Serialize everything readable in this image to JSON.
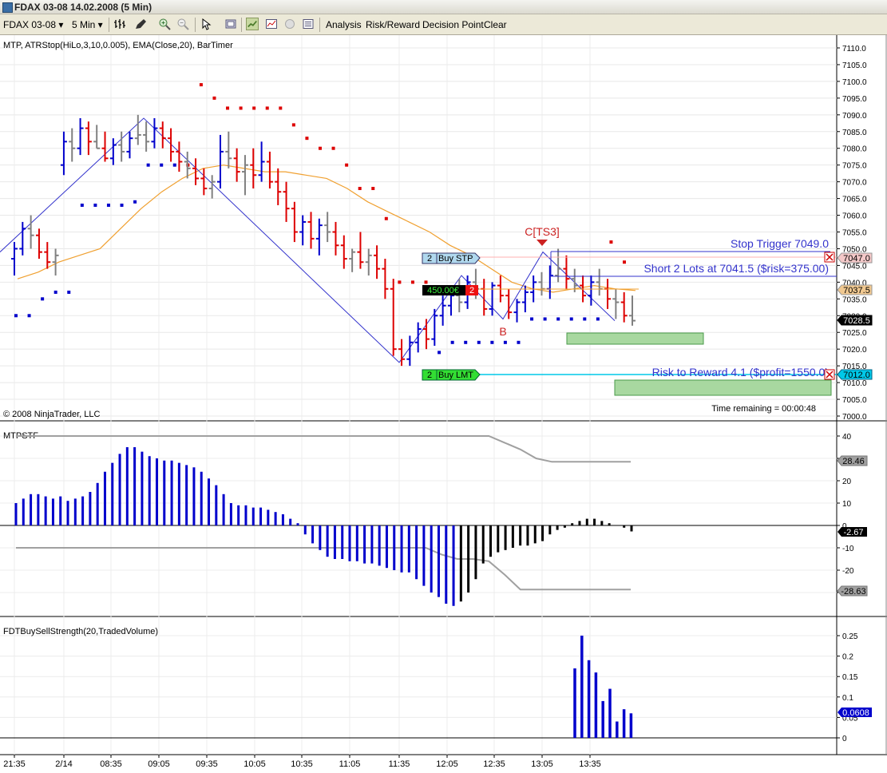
{
  "window": {
    "title": "FDAX 03-08  14.02.2008 (5 Min)"
  },
  "toolbar": {
    "instrument": "FDAX 03-08",
    "interval": "5 Min",
    "menus": [
      "Analysis",
      "Risk/Reward",
      "Decision Point",
      "Clear"
    ]
  },
  "price_panel": {
    "indicator_label": "MTP, ATRStop(HiLo,3,10,0.005), EMA(Close,20), BarTimer",
    "copyright": "© 2008 NinjaTrader, LLC",
    "time_remaining": "Time remaining = 00:00:48",
    "y_ticks": [
      "7110.0",
      "7105.0",
      "7100.0",
      "7095.0",
      "7090.0",
      "7085.0",
      "7080.0",
      "7075.0",
      "7070.0",
      "7065.0",
      "7060.0",
      "7055.0",
      "7050.0",
      "7045.0",
      "7040.0",
      "7035.0",
      "7030.0",
      "7025.0",
      "7020.0",
      "7015.0",
      "7010.0",
      "7005.0",
      "7000.0"
    ],
    "markers": {
      "current": "7028.5",
      "ema": "7037.5",
      "stop": "7047.0",
      "target": "7012.0"
    },
    "annotations": {
      "stop_trigger": "Stop Trigger 7049.0",
      "short": "Short 2 Lots at 7041.5 ($risk=375.00)",
      "risk_reward": "Risk to Reward 4.1 ($profit=1550.0)",
      "point_c": "C[TS3]",
      "point_b": "B"
    },
    "orders": {
      "buy_stp": {
        "qty": "2",
        "label": "Buy STP"
      },
      "position": {
        "pnl": "450.00€",
        "qty": "2"
      },
      "buy_lmt": {
        "qty": "2",
        "label": "Buy LMT"
      }
    },
    "colors": {
      "up_bar": "#0000cc",
      "down_bar": "#dd0000",
      "neutral_bar": "#808080",
      "ema": "#f0a020",
      "zigzag": "#3333cc",
      "atr_stop_long": "#0000cc",
      "atr_stop_short": "#dd0000"
    }
  },
  "osc_panel": {
    "label": "MTPSTF",
    "y_ticks": [
      "40",
      "30",
      "20",
      "10",
      "0",
      "-10",
      "-20",
      "-30"
    ],
    "markers": {
      "upper": "28.46",
      "current": "-2.67",
      "lower": "-28.63"
    }
  },
  "volume_panel": {
    "label": "FDTBuySellStrength(20,TradedVolume)",
    "y_ticks": [
      "0.25",
      "0.2",
      "0.15",
      "0.1",
      "0.05",
      "0"
    ],
    "markers": {
      "current": "0.0608"
    }
  },
  "x_axis": {
    "labels": [
      "21:35",
      "2/14",
      "08:35",
      "09:05",
      "09:35",
      "10:05",
      "10:35",
      "11:05",
      "11:35",
      "12:05",
      "12:35",
      "13:05",
      "13:35"
    ]
  },
  "chart_data": [
    {
      "type": "ohlc",
      "title": "FDAX 03-08 (5 Min)",
      "ylim": [
        7000,
        7110
      ],
      "indicators": [
        "MTP",
        "ATRStop(HiLo,3,10,0.005)",
        "EMA(Close,20)",
        "BarTimer"
      ],
      "ohlc": [
        [
          7047,
          7052,
          7042,
          7050
        ],
        [
          7050,
          7058,
          7048,
          7056
        ],
        [
          7056,
          7060,
          7050,
          7054
        ],
        [
          7054,
          7056,
          7047,
          7049
        ],
        [
          7049,
          7052,
          7044,
          7046
        ],
        [
          7046,
          7050,
          7042,
          7048
        ],
        [
          7075,
          7085,
          7072,
          7082
        ],
        [
          7082,
          7086,
          7076,
          7080
        ],
        [
          7080,
          7089,
          7078,
          7086
        ],
        [
          7086,
          7088,
          7078,
          7082
        ],
        [
          7082,
          7087,
          7080,
          7080
        ],
        [
          7080,
          7085,
          7076,
          7077
        ],
        [
          7077,
          7083,
          7075,
          7081
        ],
        [
          7081,
          7085,
          7076,
          7079
        ],
        [
          7079,
          7085,
          7077,
          7083
        ],
        [
          7083,
          7090,
          7081,
          7084
        ],
        [
          7084,
          7088,
          7079,
          7082
        ],
        [
          7082,
          7089,
          7080,
          7086
        ],
        [
          7086,
          7088,
          7080,
          7083
        ],
        [
          7083,
          7086,
          7076,
          7079
        ],
        [
          7079,
          7082,
          7073,
          7076
        ],
        [
          7076,
          7079,
          7071,
          7074
        ],
        [
          7074,
          7077,
          7069,
          7071
        ],
        [
          7071,
          7074,
          7066,
          7068
        ],
        [
          7068,
          7072,
          7065,
          7070
        ],
        [
          7070,
          7084,
          7068,
          7079
        ],
        [
          7079,
          7085,
          7074,
          7077
        ],
        [
          7077,
          7080,
          7070,
          7073
        ],
        [
          7073,
          7078,
          7066,
          7075
        ],
        [
          7075,
          7080,
          7068,
          7072
        ],
        [
          7072,
          7082,
          7070,
          7076
        ],
        [
          7076,
          7079,
          7068,
          7070
        ],
        [
          7070,
          7074,
          7063,
          7067
        ],
        [
          7067,
          7070,
          7058,
          7062
        ],
        [
          7062,
          7064,
          7052,
          7055
        ],
        [
          7055,
          7060,
          7051,
          7058
        ],
        [
          7058,
          7061,
          7050,
          7053
        ],
        [
          7053,
          7059,
          7048,
          7057
        ],
        [
          7057,
          7061,
          7052,
          7055
        ],
        [
          7055,
          7058,
          7048,
          7051
        ],
        [
          7051,
          7054,
          7044,
          7047
        ],
        [
          7047,
          7050,
          7043,
          7049
        ],
        [
          7049,
          7055,
          7044,
          7046
        ],
        [
          7046,
          7050,
          7042,
          7048
        ],
        [
          7048,
          7051,
          7041,
          7044
        ],
        [
          7044,
          7047,
          7035,
          7038
        ],
        [
          7038,
          7041,
          7018,
          7020
        ],
        [
          7020,
          7023,
          7015,
          7017
        ],
        [
          7017,
          7024,
          7015,
          7022
        ],
        [
          7022,
          7028,
          7019,
          7026
        ],
        [
          7026,
          7029,
          7020,
          7023
        ],
        [
          7023,
          7032,
          7021,
          7030
        ],
        [
          7030,
          7036,
          7027,
          7033
        ],
        [
          7033,
          7039,
          7030,
          7036
        ],
        [
          7036,
          7041,
          7031,
          7034
        ],
        [
          7034,
          7042,
          7032,
          7040
        ],
        [
          7040,
          7044,
          7035,
          7038
        ],
        [
          7038,
          7041,
          7030,
          7032
        ],
        [
          7032,
          7040,
          7030,
          7039
        ],
        [
          7039,
          7042,
          7034,
          7036
        ],
        [
          7036,
          7038,
          7029,
          7031
        ],
        [
          7031,
          7035,
          7028,
          7034
        ],
        [
          7034,
          7039,
          7031,
          7037
        ],
        [
          7037,
          7042,
          7034,
          7040
        ],
        [
          7040,
          7043,
          7036,
          7038
        ],
        [
          7038,
          7045,
          7035,
          7042
        ],
        [
          7042,
          7050,
          7040,
          7044
        ],
        [
          7044,
          7048,
          7038,
          7041
        ],
        [
          7041,
          7044,
          7037,
          7039
        ],
        [
          7039,
          7042,
          7034,
          7036
        ],
        [
          7036,
          7042,
          7033,
          7040
        ],
        [
          7040,
          7044,
          7036,
          7038
        ],
        [
          7038,
          7041,
          7032,
          7035
        ],
        [
          7035,
          7038,
          7029,
          7034
        ],
        [
          7034,
          7037,
          7028,
          7030
        ],
        [
          7030,
          7036,
          7027,
          7028.5
        ]
      ],
      "ema_close_20": [
        7041,
        7043,
        7046,
        7048,
        7050,
        7056,
        7062,
        7067,
        7071,
        7074,
        7075,
        7074,
        7073,
        7073,
        7072,
        7071,
        7068,
        7064,
        7061,
        7058,
        7055,
        7051,
        7048,
        7044,
        7040,
        7038,
        7037,
        7038,
        7039,
        7038,
        7037.5
      ],
      "zigzag": [
        {
          "x": "21:35",
          "y": 7049
        },
        {
          "x": "08:55",
          "y": 7089
        },
        {
          "x": "11:35",
          "y": 7016
        },
        {
          "x": "12:10",
          "y": 7042
        },
        {
          "x": "12:40",
          "y": 7029
        },
        {
          "x": "13:05",
          "y": 7049
        },
        {
          "x": "13:45",
          "y": 7028.5
        }
      ],
      "atr_stop": [
        7030,
        7030,
        7035,
        7037,
        7037,
        7063,
        7063,
        7063,
        7063,
        7064,
        7075,
        7075,
        7075,
        7075,
        7099,
        7095,
        7092,
        7092,
        7092,
        7092,
        7092,
        7087,
        7083,
        7080,
        7080,
        7075,
        7068,
        7068,
        7059,
        7040,
        7040,
        7040,
        7019,
        7022,
        7022,
        7022,
        7022,
        7022,
        7022,
        7029,
        7029,
        7029,
        7029,
        7029,
        7029,
        7052,
        7046
      ],
      "levels": {
        "stop_trigger": 7049.0,
        "short_entry": 7041.5,
        "buy_stop": 7047.0,
        "buy_limit": 7012.0,
        "ema": 7037.5,
        "last": 7028.5
      }
    },
    {
      "type": "bar",
      "title": "MTPSTF",
      "ylim": [
        -35,
        45
      ],
      "values": [
        10,
        12,
        14,
        14,
        13,
        12,
        13,
        11,
        12,
        13,
        15,
        19,
        24,
        28,
        32,
        35,
        35,
        33,
        31,
        30,
        29,
        29,
        28,
        27,
        26,
        24,
        21,
        18,
        14,
        10,
        9,
        9,
        8,
        8,
        7,
        6,
        5,
        3,
        1,
        -4,
        -8,
        -11,
        -14,
        -15,
        -15,
        -16,
        -16,
        -17,
        -17,
        -18,
        -19,
        -20,
        -21,
        -21,
        -24,
        -27,
        -30,
        -32,
        -35,
        -36,
        -34,
        -30,
        -24,
        -17,
        -14,
        -12,
        -11,
        -10,
        -9,
        -9,
        -8,
        -7,
        -4,
        -2,
        -1,
        1,
        2,
        3,
        3,
        2,
        1,
        0,
        -1,
        -2.67
      ],
      "upper_band": [
        40,
        40,
        40,
        40,
        40,
        40,
        40,
        40,
        40,
        40,
        40,
        40,
        40,
        40,
        40,
        40,
        40,
        40,
        40,
        40,
        40,
        40,
        40,
        40,
        40,
        40,
        40,
        40,
        40,
        40,
        40,
        37,
        34,
        30,
        28.46,
        28.46,
        28.46,
        28.46,
        28.46,
        28.46
      ],
      "lower_band": [
        -10,
        -10,
        -10,
        -10,
        -10,
        -10,
        -10,
        -10,
        -10,
        -10,
        -10,
        -10,
        -10,
        -10,
        -10,
        -10,
        -10,
        -10,
        -10,
        -10,
        -10,
        -10,
        -10,
        -10,
        -10,
        -10,
        -10,
        -13,
        -15,
        -15,
        -16,
        -22,
        -28.63,
        -28.63,
        -28.63,
        -28.63,
        -28.63,
        -28.63,
        -28.63,
        -28.63
      ],
      "last": -2.67
    },
    {
      "type": "bar",
      "title": "FDTBuySellStrength(20,TradedVolume)",
      "ylim": [
        0,
        0.27
      ],
      "values": [
        0.17,
        0.25,
        0.19,
        0.16,
        0.09,
        0.12,
        0.04,
        0.07,
        0.06
      ],
      "last": 0.0608
    }
  ]
}
